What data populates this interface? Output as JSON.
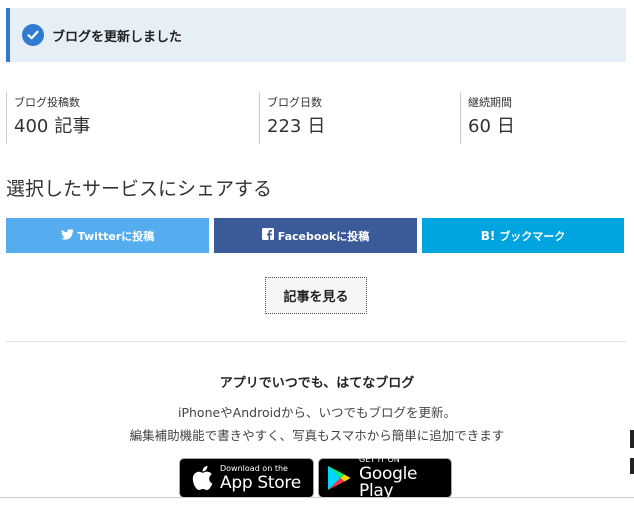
{
  "notice": {
    "message": "ブログを更新しました",
    "color": "#2e7bd0"
  },
  "stats": [
    {
      "label": "ブログ投稿数",
      "value": "400",
      "unit": "記事"
    },
    {
      "label": "ブログ日数",
      "value": "223",
      "unit": "日"
    },
    {
      "label": "継続期間",
      "value": "60",
      "unit": "日"
    }
  ],
  "share": {
    "heading": "選択したサービスにシェアする",
    "twitter_label": "Twitterに投稿",
    "facebook_label": "Facebookに投稿",
    "hatena_mark": "B!",
    "hatena_label": "ブックマーク",
    "colors": {
      "twitter": "#55acee",
      "facebook": "#3b5a9a",
      "hatena": "#00a4de"
    }
  },
  "view_article_label": "記事を見る",
  "app": {
    "title": "アプリでいつでも、はてなブログ",
    "line1": "iPhoneやAndroidから、いつでもブログを更新。",
    "line2": "編集補助機能で書きやすく、写真もスマホから簡単に追加できます",
    "app_store": {
      "small": "Download on the",
      "big": "App Store"
    },
    "google_play": {
      "small": "GET IT ON",
      "big": "Google Play"
    }
  }
}
